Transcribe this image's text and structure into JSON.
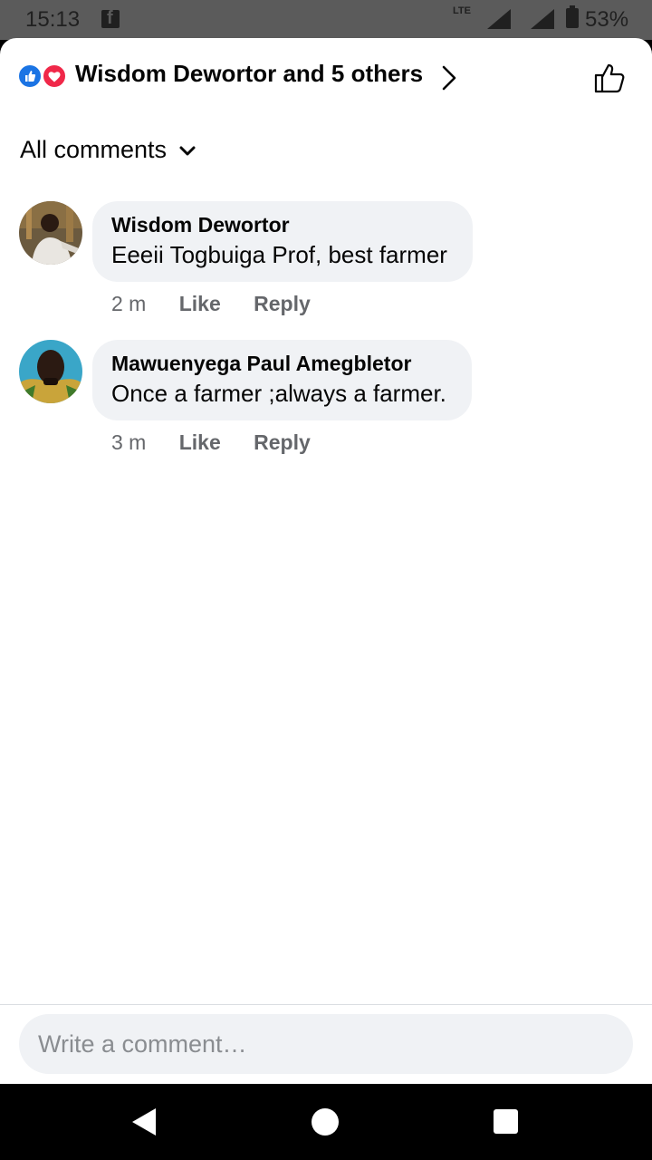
{
  "status_bar": {
    "time": "15:13",
    "network": "LTE",
    "battery": "53%"
  },
  "header": {
    "reactions_summary": "Wisdom Dewortor and 5 others"
  },
  "sort": {
    "label": "All comments"
  },
  "comments": [
    {
      "author": "Wisdom Dewortor",
      "text": "Eeeii Togbuiga Prof, best farmer",
      "time": "2 m",
      "like_label": "Like",
      "reply_label": "Reply"
    },
    {
      "author": "Mawuenyega Paul Amegbletor",
      "text": "Once a farmer ;always a farmer.",
      "time": "3 m",
      "like_label": "Like",
      "reply_label": "Reply"
    }
  ],
  "composer": {
    "placeholder": "Write a comment…"
  },
  "colors": {
    "like_blue": "#1b74e4",
    "love_red": "#f02849",
    "bubble_gray": "#f0f2f5",
    "meta_gray": "#65676b"
  }
}
